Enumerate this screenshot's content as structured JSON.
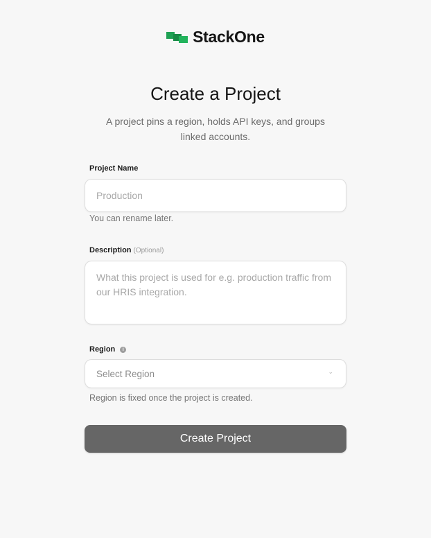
{
  "brand": {
    "name": "StackOne",
    "logo_icon": "stackone-logo-icon",
    "logo_color": "#1fa154"
  },
  "heading": {
    "title": "Create a Project",
    "subtitle": "A project pins a region, holds API keys, and groups linked accounts."
  },
  "form": {
    "project_name": {
      "label": "Project Name",
      "placeholder": "Production",
      "value": "",
      "hint": "You can rename later."
    },
    "description": {
      "label": "Description",
      "optional_tag": "(Optional)",
      "placeholder": "What this project is used for e.g. production traffic from our HRIS integration.",
      "value": ""
    },
    "region": {
      "label": "Region",
      "info_icon": "info-icon",
      "selected": "Select Region",
      "chevron_icon": "chevron-down-icon",
      "hint": "Region is fixed once the project is created."
    },
    "submit_label": "Create Project"
  },
  "colors": {
    "background": "#f7f7f7",
    "button": "#666666",
    "button_text": "#ffffff"
  }
}
